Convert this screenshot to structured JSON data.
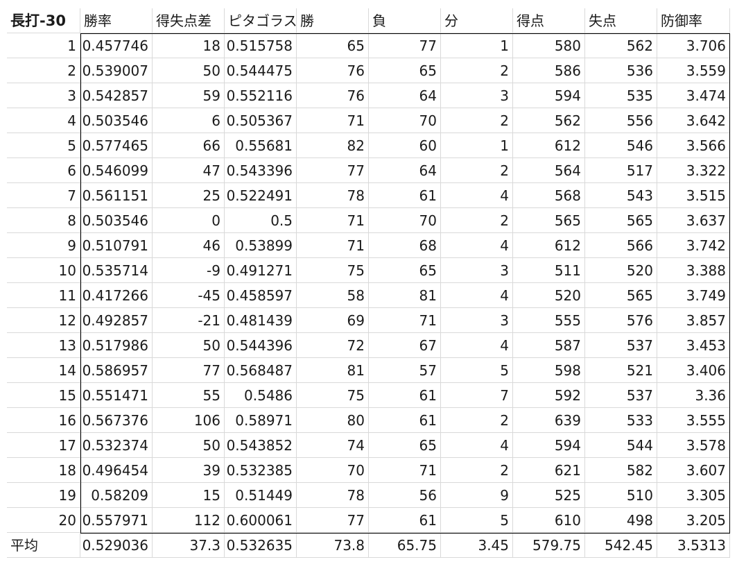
{
  "sheet": {
    "title": "長打-30",
    "headers": [
      "勝率",
      "得失点差",
      "ピタゴラス",
      "勝",
      "負",
      "分",
      "得点",
      "失点",
      "防御率"
    ],
    "rows": [
      [
        "1",
        "0.457746",
        "18",
        "0.515758",
        "65",
        "77",
        "1",
        "580",
        "562",
        "3.706"
      ],
      [
        "2",
        "0.539007",
        "50",
        "0.544475",
        "76",
        "65",
        "2",
        "586",
        "536",
        "3.559"
      ],
      [
        "3",
        "0.542857",
        "59",
        "0.552116",
        "76",
        "64",
        "3",
        "594",
        "535",
        "3.474"
      ],
      [
        "4",
        "0.503546",
        "6",
        "0.505367",
        "71",
        "70",
        "2",
        "562",
        "556",
        "3.642"
      ],
      [
        "5",
        "0.577465",
        "66",
        "0.55681",
        "82",
        "60",
        "1",
        "612",
        "546",
        "3.566"
      ],
      [
        "6",
        "0.546099",
        "47",
        "0.543396",
        "77",
        "64",
        "2",
        "564",
        "517",
        "3.322"
      ],
      [
        "7",
        "0.561151",
        "25",
        "0.522491",
        "78",
        "61",
        "4",
        "568",
        "543",
        "3.515"
      ],
      [
        "8",
        "0.503546",
        "0",
        "0.5",
        "71",
        "70",
        "2",
        "565",
        "565",
        "3.637"
      ],
      [
        "9",
        "0.510791",
        "46",
        "0.53899",
        "71",
        "68",
        "4",
        "612",
        "566",
        "3.742"
      ],
      [
        "10",
        "0.535714",
        "-9",
        "0.491271",
        "75",
        "65",
        "3",
        "511",
        "520",
        "3.388"
      ],
      [
        "11",
        "0.417266",
        "-45",
        "0.458597",
        "58",
        "81",
        "4",
        "520",
        "565",
        "3.749"
      ],
      [
        "12",
        "0.492857",
        "-21",
        "0.481439",
        "69",
        "71",
        "3",
        "555",
        "576",
        "3.857"
      ],
      [
        "13",
        "0.517986",
        "50",
        "0.544396",
        "72",
        "67",
        "4",
        "587",
        "537",
        "3.453"
      ],
      [
        "14",
        "0.586957",
        "77",
        "0.568487",
        "81",
        "57",
        "5",
        "598",
        "521",
        "3.406"
      ],
      [
        "15",
        "0.551471",
        "55",
        "0.5486",
        "75",
        "61",
        "7",
        "592",
        "537",
        "3.36"
      ],
      [
        "16",
        "0.567376",
        "106",
        "0.58971",
        "80",
        "61",
        "2",
        "639",
        "533",
        "3.555"
      ],
      [
        "17",
        "0.532374",
        "50",
        "0.543852",
        "74",
        "65",
        "4",
        "594",
        "544",
        "3.578"
      ],
      [
        "18",
        "0.496454",
        "39",
        "0.532385",
        "70",
        "71",
        "2",
        "621",
        "582",
        "3.607"
      ],
      [
        "19",
        "0.58209",
        "15",
        "0.51449",
        "78",
        "56",
        "9",
        "525",
        "510",
        "3.305"
      ],
      [
        "20",
        "0.557971",
        "112",
        "0.600061",
        "77",
        "61",
        "5",
        "610",
        "498",
        "3.205"
      ]
    ],
    "average": [
      "平均",
      "0.529036",
      "37.3",
      "0.532635",
      "73.8",
      "65.75",
      "3.45",
      "579.75",
      "542.45",
      "3.5313"
    ]
  },
  "colors": {
    "gridline": "#d9d9d9",
    "outline": "#000000",
    "text": "#1a1a1a"
  }
}
